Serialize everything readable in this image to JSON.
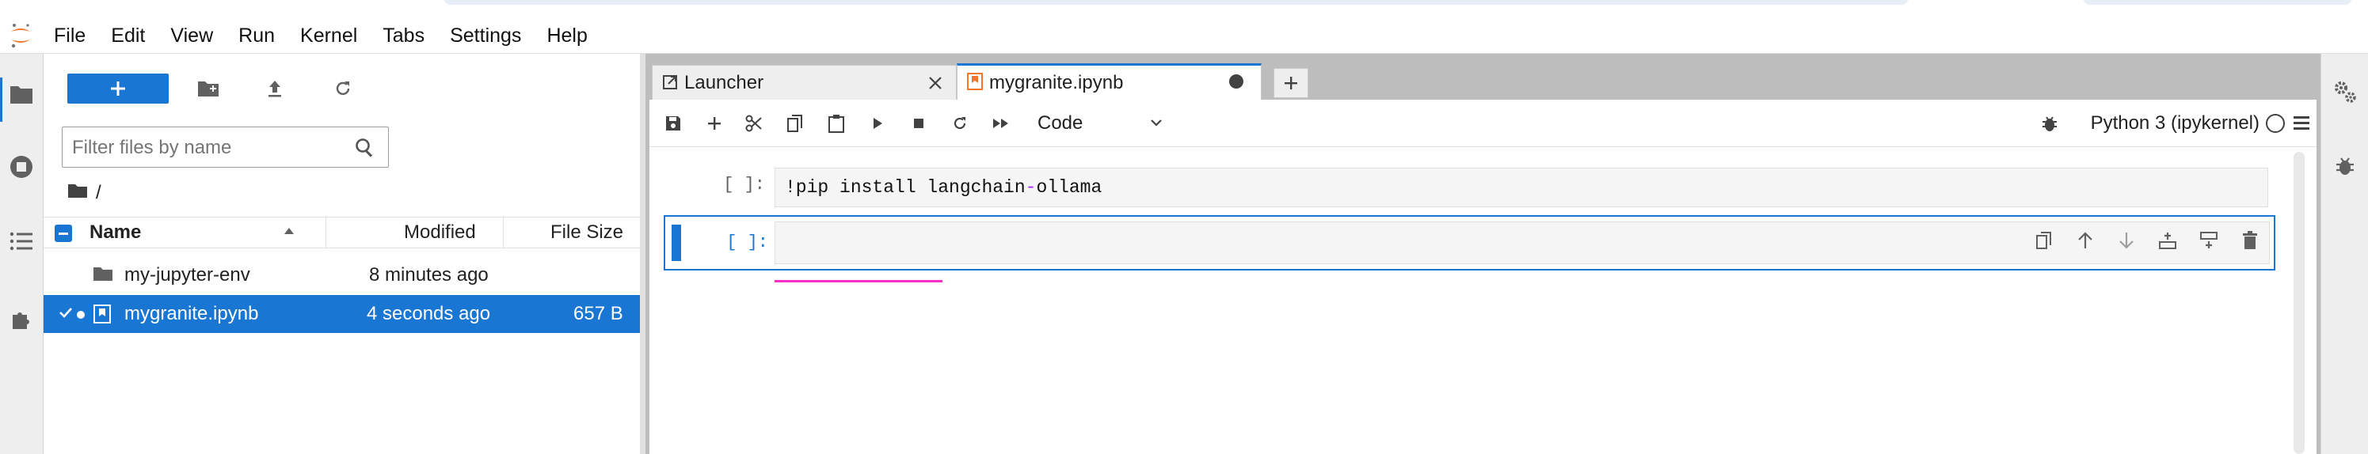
{
  "menubar": {
    "items": [
      "File",
      "Edit",
      "View",
      "Run",
      "Kernel",
      "Tabs",
      "Settings",
      "Help"
    ]
  },
  "activity_bar": {
    "icons": [
      "folder-icon",
      "running-sessions-icon",
      "table-of-contents-icon",
      "extension-icon"
    ]
  },
  "file_browser": {
    "search_placeholder": "Filter files by name",
    "breadcrumb": "/",
    "columns": {
      "name": "Name",
      "modified": "Modified",
      "size": "File Size"
    },
    "files": [
      {
        "name": "my-jupyter-env",
        "type": "folder",
        "modified": "8 minutes ago",
        "size": "",
        "selected": false
      },
      {
        "name": "mygranite.ipynb",
        "type": "notebook",
        "modified": "4 seconds ago",
        "size": "657 B",
        "selected": true
      }
    ]
  },
  "tabs": [
    {
      "label": "Launcher",
      "icon": "launcher-icon",
      "current": false
    },
    {
      "label": "mygranite.ipynb",
      "icon": "notebook-icon",
      "current": true
    }
  ],
  "notebook": {
    "cell_type": "Code",
    "kernel_name": "Python 3 (ipykernel)",
    "cells": [
      {
        "prompt": "[ ]:",
        "source_pre": "!pip install langchain",
        "source_op": "-",
        "source_post": "ollama"
      },
      {
        "prompt": "[ ]:",
        "source": ""
      }
    ]
  },
  "colors": {
    "accent": "#1976d2",
    "magenta": "#ff2ec4",
    "logo_orange": "#f37726"
  }
}
